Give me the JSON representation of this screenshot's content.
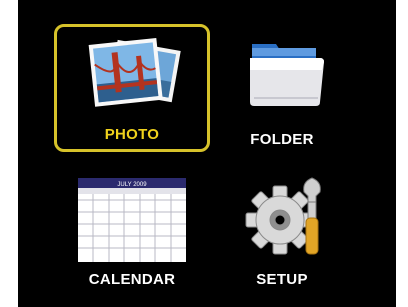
{
  "menu": {
    "items": [
      {
        "label": "PHOTO",
        "icon": "photo-stack-icon",
        "selected": true
      },
      {
        "label": "FOLDER",
        "icon": "folder-icon",
        "selected": false
      },
      {
        "label": "CALENDAR",
        "icon": "calendar-icon",
        "selected": false
      },
      {
        "label": "SETUP",
        "icon": "gear-wrench-icon",
        "selected": false
      }
    ]
  },
  "calendar": {
    "header": "JULY 2009"
  },
  "colors": {
    "background": "#000000",
    "selection_border": "#d6c22a",
    "selected_label": "#f0d21c",
    "label": "#ffffff"
  }
}
